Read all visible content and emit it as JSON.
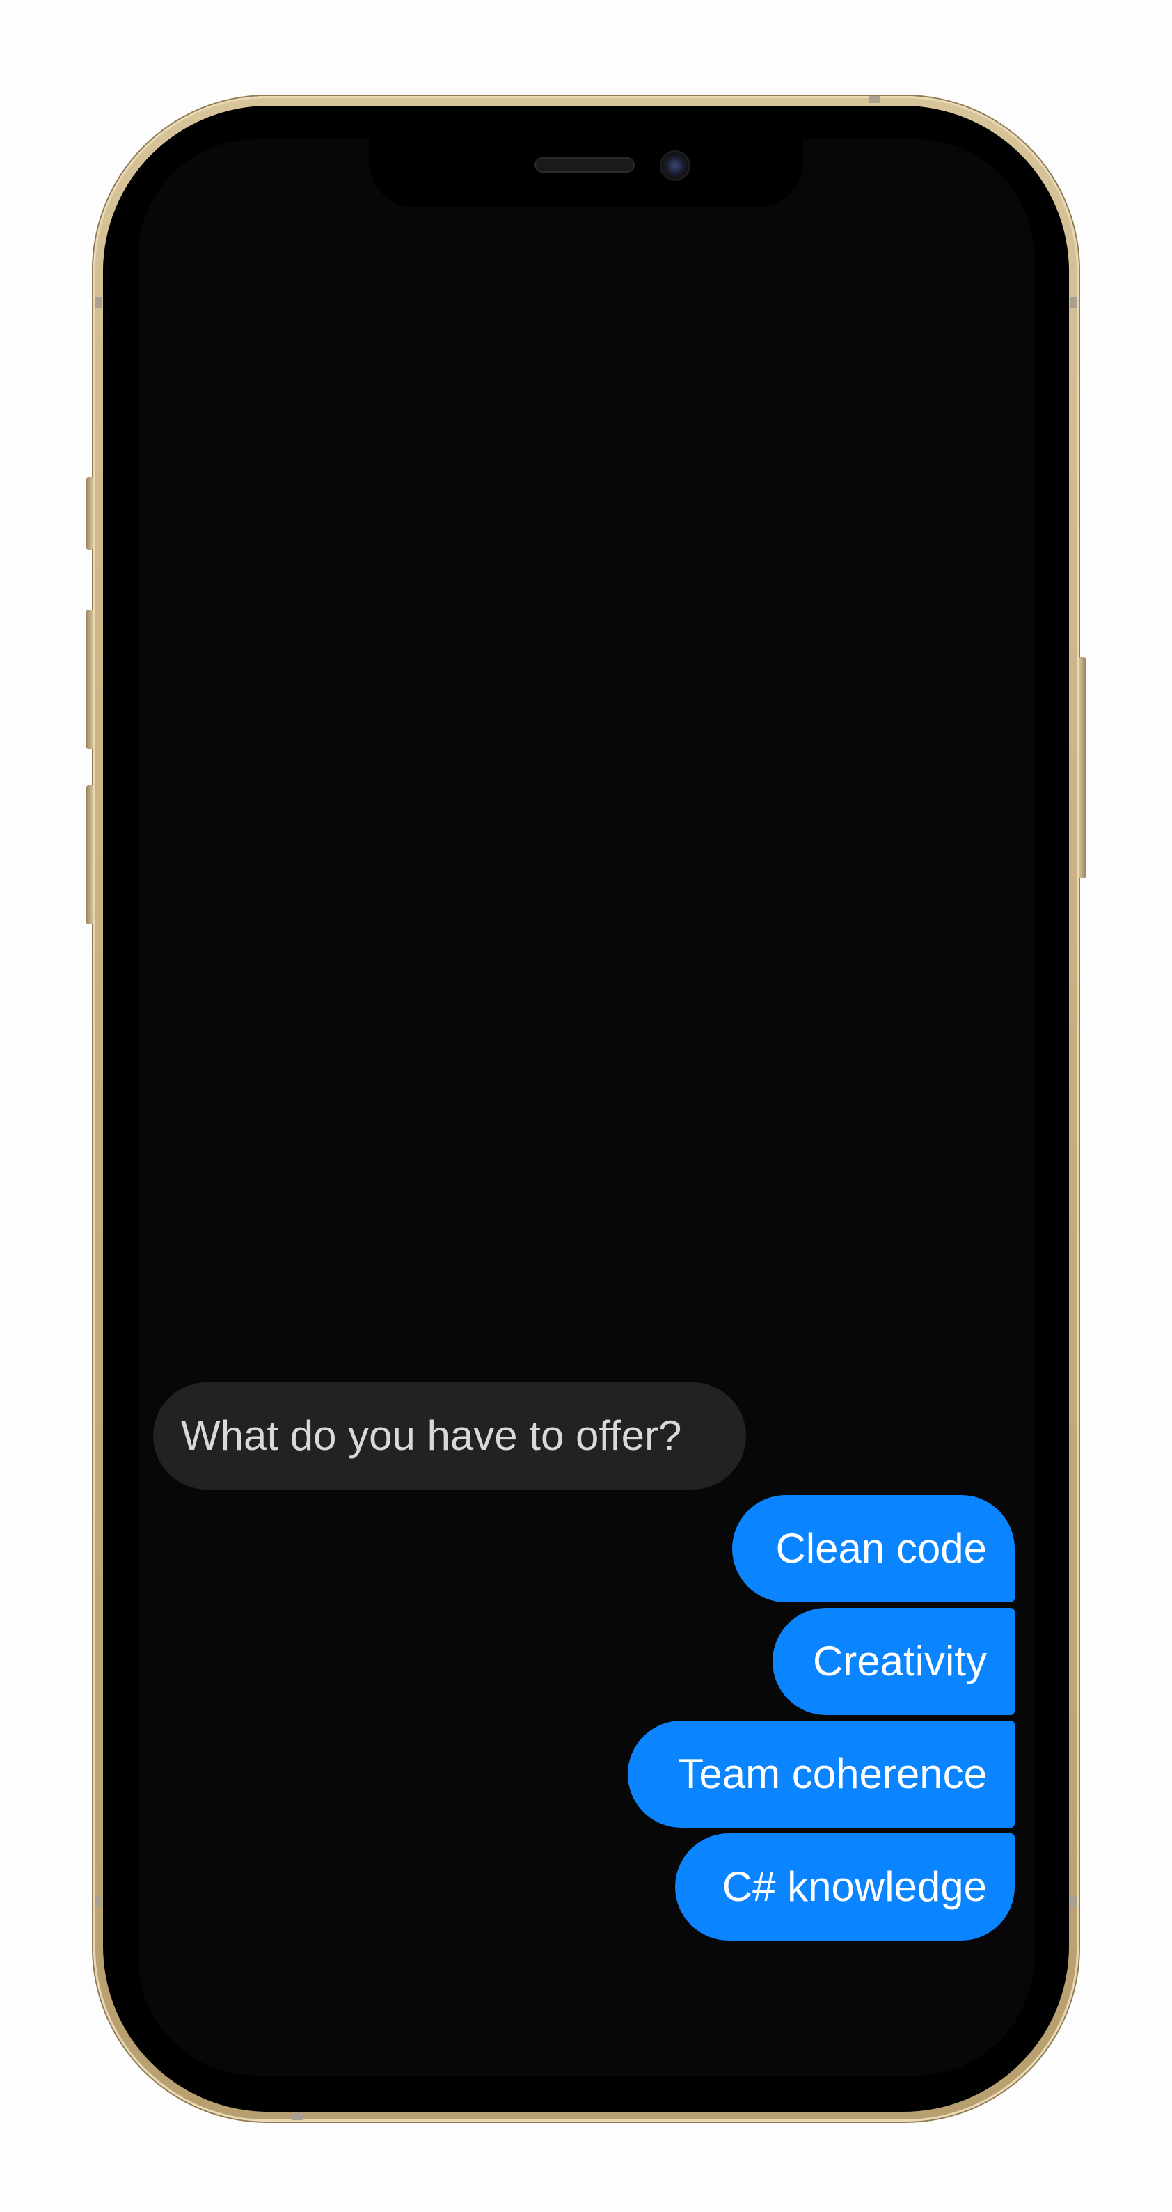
{
  "conversation": {
    "messages": [
      {
        "sender": "them",
        "text": "What do you have to offer?"
      },
      {
        "sender": "me",
        "text": "Clean code"
      },
      {
        "sender": "me",
        "text": "Creativity"
      },
      {
        "sender": "me",
        "text": "Team coherence"
      },
      {
        "sender": "me",
        "text": "C# knowledge"
      }
    ]
  },
  "colors": {
    "incoming_bubble": "#222222",
    "outgoing_bubble": "#0a84ff",
    "screen_background": "#070707",
    "frame": "#c5ad7d"
  }
}
